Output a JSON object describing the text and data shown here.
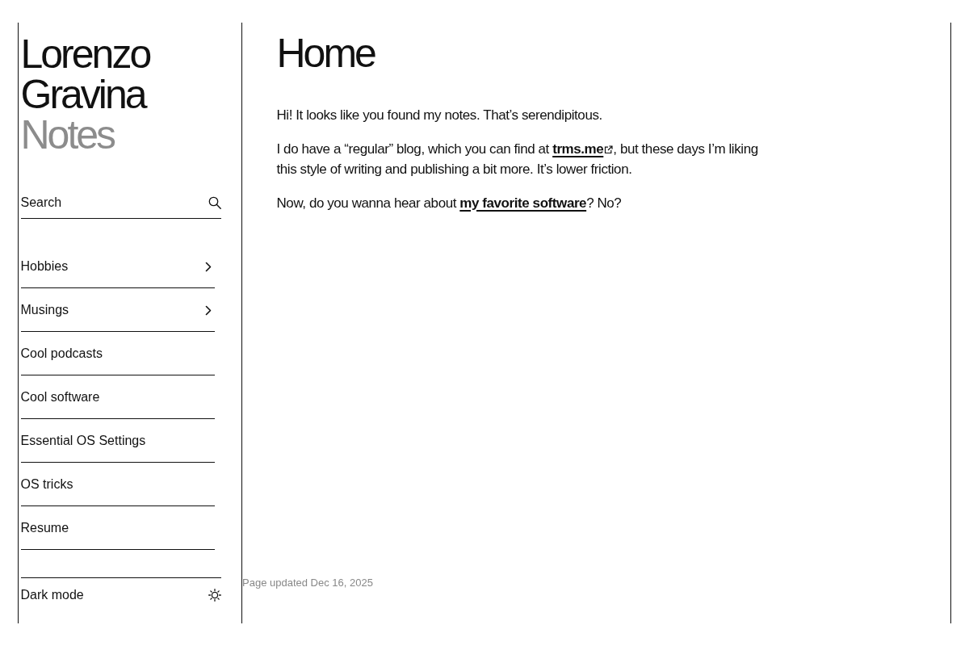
{
  "sidebar": {
    "title": "Lorenzo Gravina",
    "subtitle": "Notes",
    "search": {
      "placeholder": "Search"
    },
    "nav_items": [
      {
        "label": "Hobbies",
        "kind": "folder"
      },
      {
        "label": "Musings",
        "kind": "folder"
      },
      {
        "label": "Cool podcasts",
        "kind": "page"
      },
      {
        "label": "Cool software",
        "kind": "page"
      },
      {
        "label": "Essential OS Settings",
        "kind": "page"
      },
      {
        "label": "OS tricks",
        "kind": "page"
      },
      {
        "label": "Resume",
        "kind": "page"
      }
    ],
    "theme_toggle": {
      "label": "Dark mode"
    }
  },
  "page": {
    "title": "Home",
    "paragraphs": [
      [
        {
          "text": "Hi! It looks like you found my notes. That’s serendipitous."
        }
      ],
      [
        {
          "text": "I do have a “regular” blog, which you can find at "
        },
        {
          "link": "trms.me",
          "external": true
        },
        {
          "text": ", but these days I’m liking this style of writing and publishing a bit more. It’s lower friction."
        }
      ],
      [
        {
          "text": "Now, do you wanna hear about "
        },
        {
          "link": "my favorite software"
        },
        {
          "text": "? No?"
        }
      ]
    ]
  },
  "footer": {
    "updated": "Page updated Dec 16, 2025"
  }
}
